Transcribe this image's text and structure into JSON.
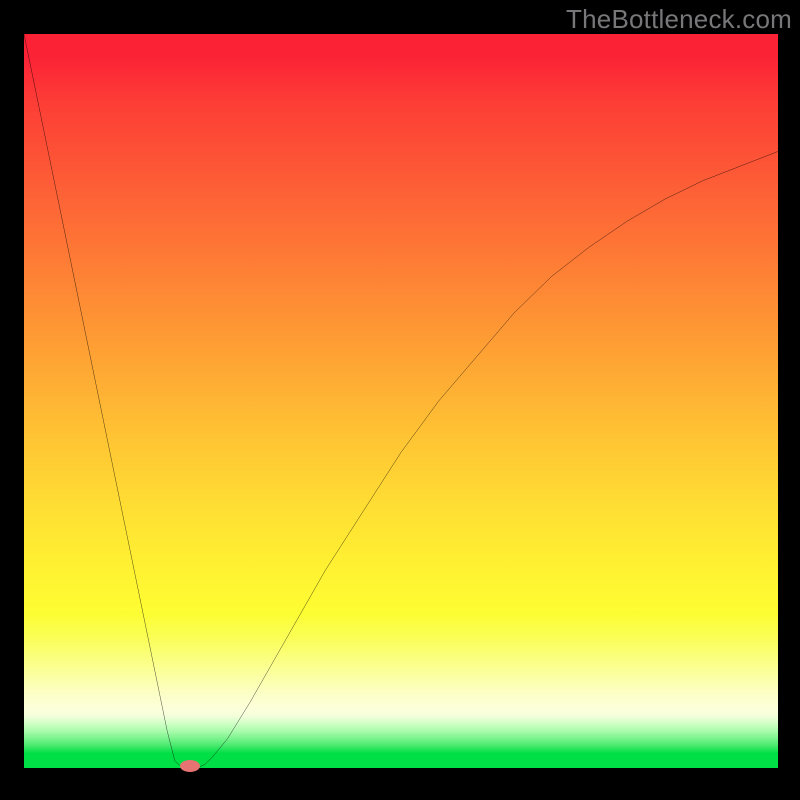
{
  "watermark": "TheBottleneck.com",
  "chart_data": {
    "type": "line",
    "title": "",
    "xlabel": "",
    "ylabel": "",
    "xlim": [
      0,
      100
    ],
    "ylim": [
      0,
      100
    ],
    "x": [
      0,
      2,
      4,
      6,
      8,
      10,
      12,
      14,
      16,
      18,
      19,
      20,
      21,
      22,
      23,
      24,
      25,
      27,
      30,
      35,
      40,
      45,
      50,
      55,
      60,
      65,
      70,
      75,
      80,
      85,
      90,
      95,
      100
    ],
    "y": [
      100,
      90,
      80,
      70,
      60,
      50,
      40,
      30,
      20,
      10,
      5,
      1,
      0,
      0,
      0,
      0.5,
      1.5,
      4,
      9,
      18,
      27,
      35,
      43,
      50,
      56,
      62,
      67,
      71,
      74.5,
      77.5,
      80,
      82,
      84
    ],
    "marker": {
      "x": 22,
      "y": 0,
      "color": "#e77372"
    },
    "grid": false,
    "legend": false,
    "background_gradient": {
      "top": "#fb2236",
      "mid": "#ffdd33",
      "bottom_green": "#00df45"
    },
    "frame_color": "#000000"
  }
}
